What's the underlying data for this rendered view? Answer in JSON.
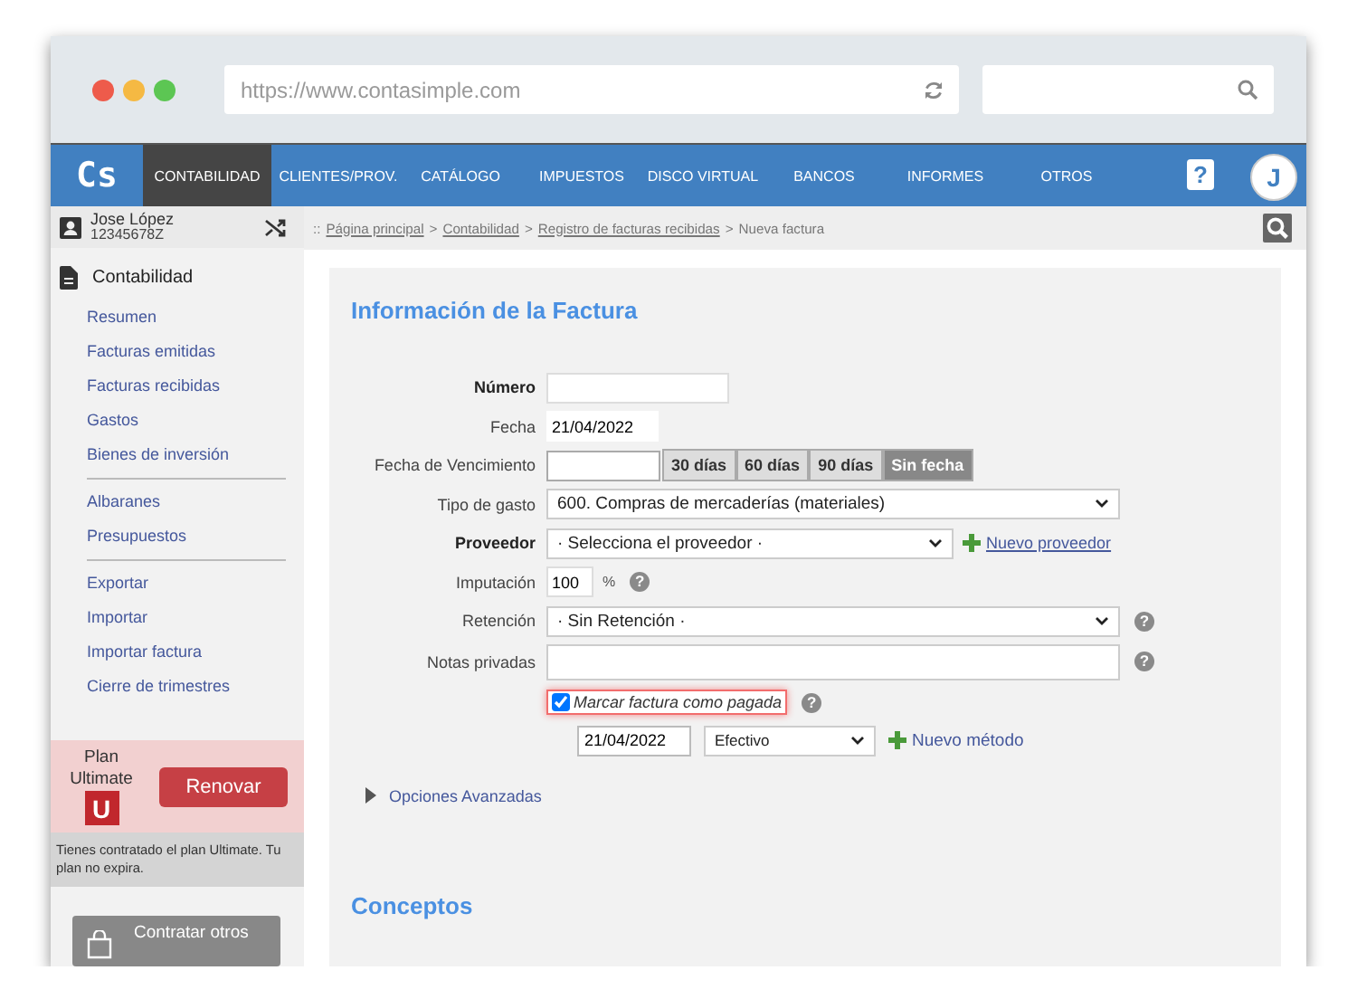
{
  "browser": {
    "url": "https://www.contasimple.com"
  },
  "nav": {
    "logo": "Cs",
    "avatar": "J",
    "help": "?",
    "items": [
      {
        "label": "CONTABILIDAD",
        "selected": true
      },
      {
        "label": "CLIENTES/PROV.",
        "selected": false
      },
      {
        "label": "CATÁLOGO",
        "selected": false
      },
      {
        "label": "IMPUESTOS",
        "selected": false
      },
      {
        "label": "DISCO VIRTUAL",
        "selected": false
      },
      {
        "label": "BANCOS",
        "selected": false
      },
      {
        "label": "INFORMES",
        "selected": false
      },
      {
        "label": "OTROS",
        "selected": false
      }
    ]
  },
  "user": {
    "name": "Jose López",
    "id": "12345678Z"
  },
  "sidebar": {
    "section": "Contabilidad",
    "groups": [
      [
        "Resumen",
        "Facturas emitidas",
        "Facturas recibidas",
        "Gastos",
        "Bienes de inversión"
      ],
      [
        "Albaranes",
        "Presupuestos"
      ],
      [
        "Exportar",
        "Importar",
        "Importar factura",
        "Cierre de trimestres"
      ]
    ]
  },
  "plan": {
    "label": "Plan",
    "name": "Ultimate",
    "badge": "U",
    "button": "Renovar",
    "note": "Tienes contratado el plan Ultimate. Tu plan no expira.",
    "other_button": "Contratar otros"
  },
  "breadcrumb": {
    "prefix": "::",
    "separator": ">",
    "items": [
      {
        "label": "Página principal",
        "link": true
      },
      {
        "label": "Contabilidad",
        "link": true
      },
      {
        "label": "Registro de facturas recibidas",
        "link": true
      },
      {
        "label": "Nueva factura",
        "link": false
      }
    ]
  },
  "form": {
    "title": "Información de la Factura",
    "fields": [
      {
        "kind": "text",
        "label": "Número",
        "required": true
      },
      {
        "kind": "date",
        "label": "Fecha",
        "required": false,
        "value": "21/04/2022"
      },
      {
        "kind": "due",
        "label": "Fecha de Vencimiento",
        "required": false,
        "options": [
          {
            "label": "30 días",
            "selected": false
          },
          {
            "label": "60 días",
            "selected": false
          },
          {
            "label": "90 días",
            "selected": false
          },
          {
            "label": "Sin fecha",
            "selected": true
          }
        ]
      },
      {
        "kind": "select",
        "label": "Tipo de gasto",
        "required": false,
        "value": "600. Compras de mercaderías (materiales)"
      },
      {
        "kind": "supplier",
        "label": "Proveedor",
        "required": true,
        "value": "· Selecciona el proveedor ·",
        "link": "Nuevo proveedor"
      },
      {
        "kind": "percent",
        "label": "Imputación",
        "required": false,
        "value": "100",
        "unit": "%",
        "help": "?"
      },
      {
        "kind": "select",
        "label": "Retención",
        "required": false,
        "value": "· Sin Retención ·",
        "help": "?"
      },
      {
        "kind": "textarea",
        "label": "Notas privadas",
        "required": false,
        "help": "?"
      }
    ],
    "paid": {
      "label": "Marcar factura como pagada",
      "checked": true,
      "help": "?",
      "date": "21/04/2022",
      "method": "Efectivo",
      "link": "Nuevo método"
    },
    "advanced": {
      "label": "Opciones Avanzadas",
      "expanded": false
    },
    "section2": "Conceptos"
  }
}
